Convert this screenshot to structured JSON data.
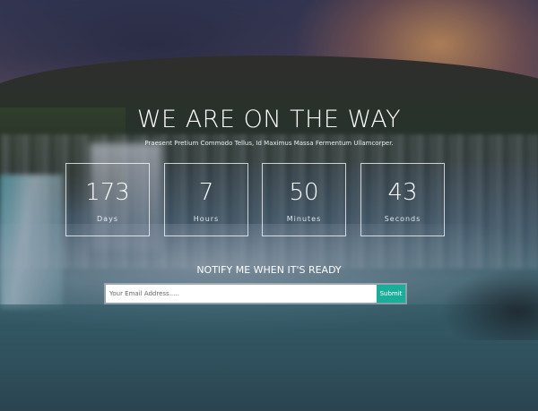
{
  "hero": {
    "title": "WE ARE ON THE WAY",
    "subtitle": "Praesent Pretium Commodo Tellus, Id Maximus Massa Fermentum Ullamcorper."
  },
  "countdown": [
    {
      "value": "173",
      "unit": "Days"
    },
    {
      "value": "7",
      "unit": "Hours"
    },
    {
      "value": "50",
      "unit": "Minutes"
    },
    {
      "value": "43",
      "unit": "Seconds"
    }
  ],
  "notify": {
    "heading": "NOTIFY ME WHEN IT'S READY",
    "email_placeholder": "Your Email Address.....",
    "submit_label": "Submit"
  },
  "colors": {
    "accent": "#1aae9a",
    "text": "#ffffff"
  }
}
